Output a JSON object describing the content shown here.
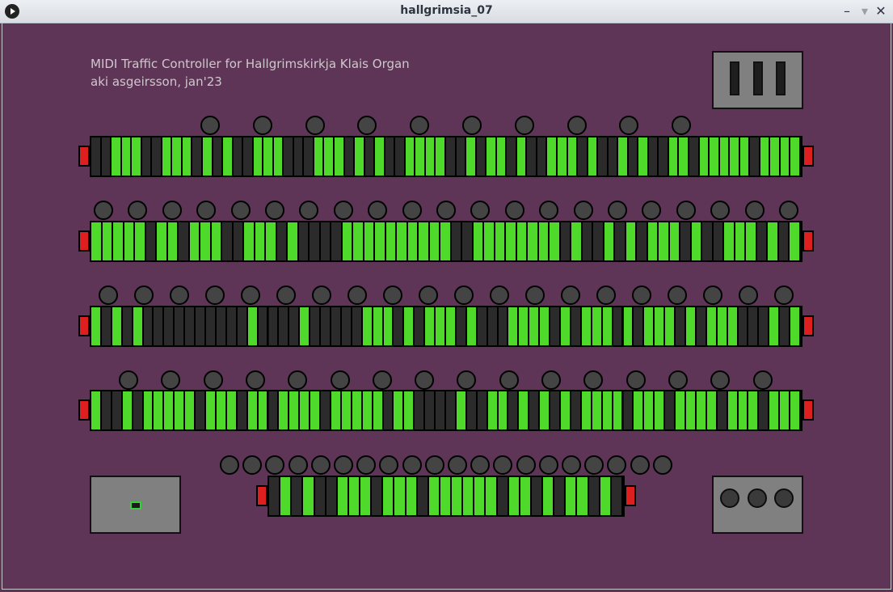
{
  "window": {
    "title": "hallgrimsia_07"
  },
  "info": {
    "line1": "MIDI Traffic Controller for Hallgrimskirkja Klais Organ",
    "line2": "aki asgeirsson, jan'23"
  },
  "colors": {
    "on": "#4fda2b",
    "off": "#2b2b2b",
    "cap": "#dd1f1f",
    "bg": "#5e3556"
  },
  "ranks": [
    {
      "pattern": "0011100111010100111000111010100111100101101001110100101001101111101111",
      "knobs": 10
    },
    {
      "pattern": "11111011011100111010000111111111100111111110100101011101001110101",
      "knobs": 21
    },
    {
      "pattern": "10101000000000010000100000111010111010001111010111010111010111000101",
      "knobs": 20
    },
    {
      "pattern": "10010111110111011011110111110110000100110101010111101110111101110111",
      "knobs": 16
    },
    {
      "pattern": "0101001110111011111101101011010",
      "knobs": 20
    }
  ]
}
